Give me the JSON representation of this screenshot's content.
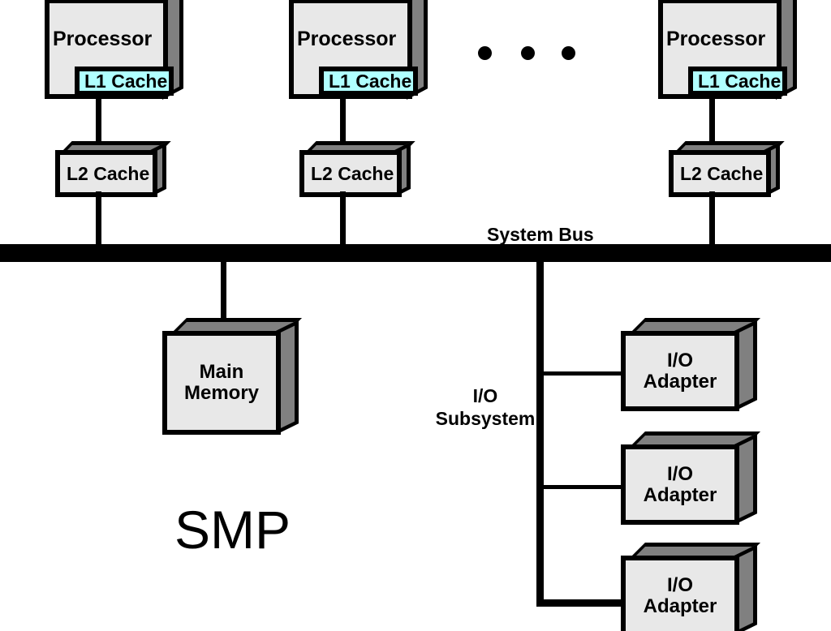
{
  "diagram": {
    "title": "SMP",
    "bus_label": "System Bus",
    "io_subsystem_label": "I/O\nSubsystem",
    "io_subsystem_line1": "I/O",
    "io_subsystem_line2": "Subsystem",
    "colors": {
      "box_fill": "#e8e8e8",
      "box_shade": "#808080",
      "cache_fill": "#b0ffff",
      "outline": "#000000",
      "background": "#ffffff"
    },
    "processors": [
      {
        "label": "Processor",
        "cache_label": "L1 Cache",
        "l2_label": "L2 Cache"
      },
      {
        "label": "Processor",
        "cache_label": "L1 Cache",
        "l2_label": "L2 Cache"
      },
      {
        "label": "Processor",
        "cache_label": "L1 Cache",
        "l2_label": "L2 Cache"
      }
    ],
    "ellipsis_dots": 3,
    "memory": {
      "line1": "Main",
      "line2": "Memory"
    },
    "io_adapters": [
      {
        "line1": "I/O",
        "line2": "Adapter"
      },
      {
        "line1": "I/O",
        "line2": "Adapter"
      },
      {
        "line1": "I/O",
        "line2": "Adapter"
      }
    ]
  }
}
